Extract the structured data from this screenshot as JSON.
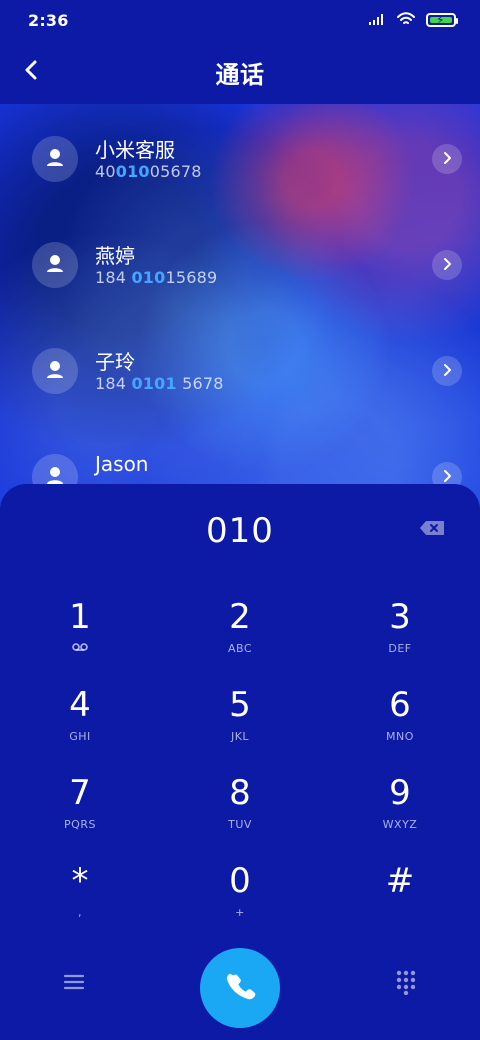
{
  "status_bar": {
    "time": "2:36"
  },
  "header": {
    "title": "通话"
  },
  "contacts": [
    {
      "name": "小米客服",
      "number_parts": {
        "a": "40",
        "b": "010",
        "c": "05678"
      }
    },
    {
      "name": "燕婷",
      "number_parts": {
        "a": "184 ",
        "b": "010",
        "c": "15689"
      }
    },
    {
      "name": "子玲",
      "number_parts": {
        "a": "184 ",
        "b": "0101",
        "c": " 5678"
      }
    },
    {
      "name": "Jason",
      "number_parts": {
        "a": "",
        "b": "",
        "c": ""
      }
    }
  ],
  "dialer": {
    "entered_number": "010",
    "keys": [
      {
        "digit": "1",
        "letters": ""
      },
      {
        "digit": "2",
        "letters": "ABC"
      },
      {
        "digit": "3",
        "letters": "DEF"
      },
      {
        "digit": "4",
        "letters": "GHI"
      },
      {
        "digit": "5",
        "letters": "JKL"
      },
      {
        "digit": "6",
        "letters": "MNO"
      },
      {
        "digit": "7",
        "letters": "PQRS"
      },
      {
        "digit": "8",
        "letters": "TUV"
      },
      {
        "digit": "9",
        "letters": "WXYZ"
      },
      {
        "digit": "*",
        "letters": ","
      },
      {
        "digit": "0",
        "letters": "+"
      },
      {
        "digit": "#",
        "letters": ""
      }
    ]
  },
  "colors": {
    "background": "#0c1aa6",
    "accent": "#1aa8f5",
    "highlight": "#45a6ff",
    "battery_fill": "#43d64a"
  },
  "icons": {
    "back": "chevron-left-icon",
    "voicemail": "voicemail-icon",
    "backspace": "backspace-icon",
    "call": "phone-icon",
    "menu": "menu-icon",
    "dialpad": "dialpad-icon"
  }
}
